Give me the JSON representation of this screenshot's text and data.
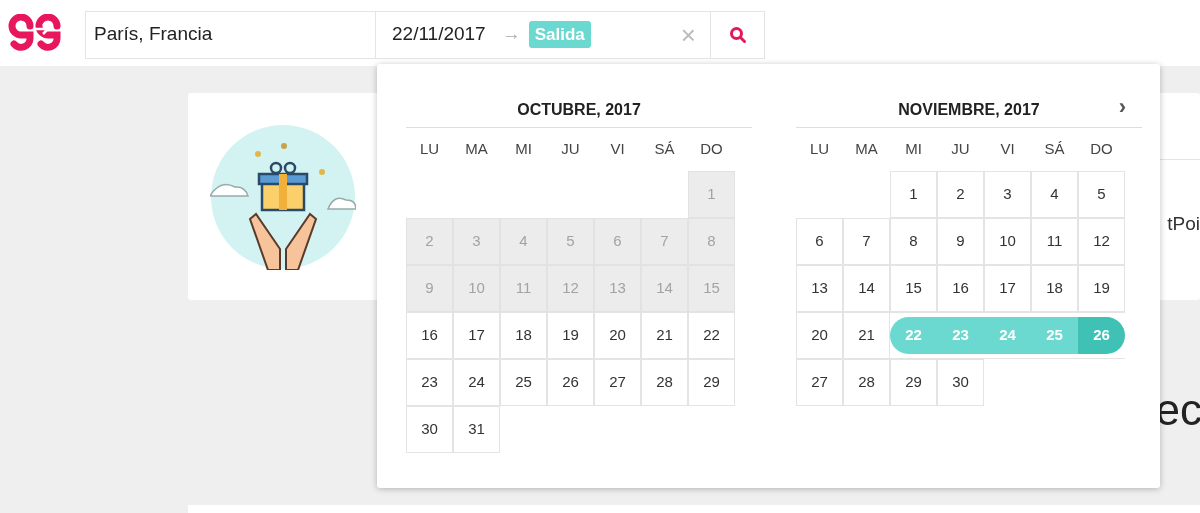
{
  "search_bar": {
    "destination": "París, Francia",
    "check_in": "22/11/2017",
    "arrow": "→",
    "check_out_badge": "Salida",
    "clear": "×"
  },
  "background": {
    "card_text": "tPoi",
    "heading": "ec"
  },
  "date_picker": {
    "next": "›",
    "months": [
      {
        "title": "OCTUBRE, 2017",
        "weekdays": [
          "LU",
          "MA",
          "MI",
          "JU",
          "VI",
          "SÁ",
          "DO"
        ],
        "weeks": [
          [
            {
              "kind": "blank"
            },
            {
              "kind": "blank"
            },
            {
              "kind": "blank"
            },
            {
              "kind": "blank"
            },
            {
              "kind": "blank"
            },
            {
              "kind": "blank"
            },
            {
              "kind": "past",
              "label": "1"
            }
          ],
          [
            {
              "kind": "past",
              "label": "2"
            },
            {
              "kind": "past",
              "label": "3"
            },
            {
              "kind": "past",
              "label": "4"
            },
            {
              "kind": "past",
              "label": "5"
            },
            {
              "kind": "past",
              "label": "6"
            },
            {
              "kind": "past",
              "label": "7"
            },
            {
              "kind": "past",
              "label": "8"
            }
          ],
          [
            {
              "kind": "past",
              "label": "9"
            },
            {
              "kind": "past",
              "label": "10"
            },
            {
              "kind": "past",
              "label": "11"
            },
            {
              "kind": "past",
              "label": "12"
            },
            {
              "kind": "past",
              "label": "13"
            },
            {
              "kind": "past",
              "label": "14"
            },
            {
              "kind": "past",
              "label": "15"
            }
          ],
          [
            {
              "kind": "day",
              "label": "16"
            },
            {
              "kind": "day",
              "label": "17"
            },
            {
              "kind": "day",
              "label": "18"
            },
            {
              "kind": "day",
              "label": "19"
            },
            {
              "kind": "day",
              "label": "20"
            },
            {
              "kind": "day",
              "label": "21"
            },
            {
              "kind": "day",
              "label": "22"
            }
          ],
          [
            {
              "kind": "day",
              "label": "23"
            },
            {
              "kind": "day",
              "label": "24"
            },
            {
              "kind": "day",
              "label": "25"
            },
            {
              "kind": "day",
              "label": "26"
            },
            {
              "kind": "day",
              "label": "27"
            },
            {
              "kind": "day",
              "label": "28"
            },
            {
              "kind": "day",
              "label": "29"
            }
          ],
          [
            {
              "kind": "day",
              "label": "30"
            },
            {
              "kind": "day",
              "label": "31"
            },
            {
              "kind": "blank"
            },
            {
              "kind": "blank"
            },
            {
              "kind": "blank"
            },
            {
              "kind": "blank"
            },
            {
              "kind": "blank"
            }
          ]
        ]
      },
      {
        "title": "NOVIEMBRE, 2017",
        "weekdays": [
          "LU",
          "MA",
          "MI",
          "JU",
          "VI",
          "SÁ",
          "DO"
        ],
        "weeks": [
          [
            {
              "kind": "blank"
            },
            {
              "kind": "blank"
            },
            {
              "kind": "day",
              "label": "1"
            },
            {
              "kind": "day",
              "label": "2"
            },
            {
              "kind": "day",
              "label": "3"
            },
            {
              "kind": "day",
              "label": "4"
            },
            {
              "kind": "day",
              "label": "5"
            }
          ],
          [
            {
              "kind": "day",
              "label": "6"
            },
            {
              "kind": "day",
              "label": "7"
            },
            {
              "kind": "day",
              "label": "8"
            },
            {
              "kind": "day",
              "label": "9"
            },
            {
              "kind": "day",
              "label": "10"
            },
            {
              "kind": "day",
              "label": "11"
            },
            {
              "kind": "day",
              "label": "12"
            }
          ],
          [
            {
              "kind": "day",
              "label": "13"
            },
            {
              "kind": "day",
              "label": "14"
            },
            {
              "kind": "day",
              "label": "15"
            },
            {
              "kind": "day",
              "label": "16"
            },
            {
              "kind": "day",
              "label": "17"
            },
            {
              "kind": "day",
              "label": "18"
            },
            {
              "kind": "day",
              "label": "19"
            }
          ],
          [
            {
              "kind": "day",
              "label": "20"
            },
            {
              "kind": "day",
              "label": "21"
            },
            {
              "kind": "range_start",
              "label": "22"
            },
            {
              "kind": "range",
              "label": "23"
            },
            {
              "kind": "range",
              "label": "24"
            },
            {
              "kind": "range",
              "label": "25"
            },
            {
              "kind": "range_end",
              "label": "26"
            }
          ],
          [
            {
              "kind": "day",
              "label": "27"
            },
            {
              "kind": "day",
              "label": "28"
            },
            {
              "kind": "day",
              "label": "29"
            },
            {
              "kind": "day",
              "label": "30"
            },
            {
              "kind": "blank"
            },
            {
              "kind": "blank"
            },
            {
              "kind": "blank"
            }
          ]
        ]
      }
    ]
  }
}
